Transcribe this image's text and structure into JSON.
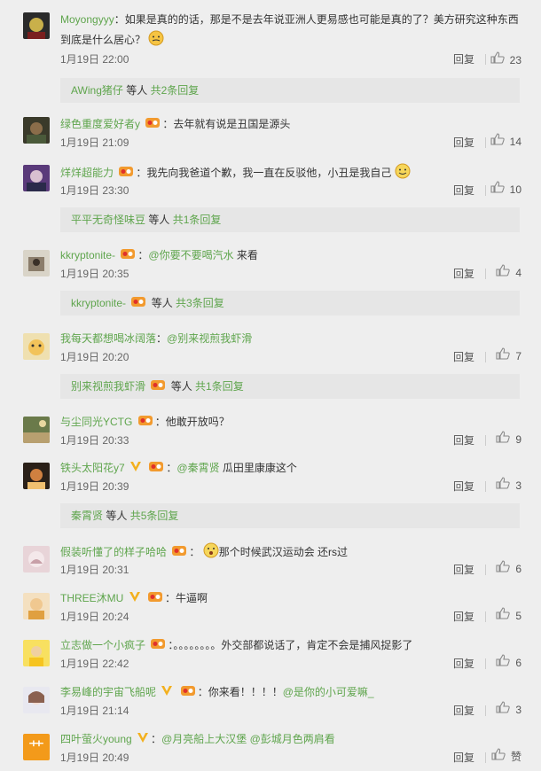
{
  "reply_label": "回复",
  "etc_text": " 等人 ",
  "comments": [
    {
      "user": "Moyongyyy",
      "colon": "：",
      "text": "如果是真的的话，那是不是去年说亚洲人更易感也可能是真的了？美方研究这种东西",
      "text2": "到底是什么居心？",
      "time": "1月19日 22:00",
      "likes": "23",
      "emoji": "thinking",
      "sub": {
        "user": "AWing猪仔",
        "count": "共2条回复"
      }
    },
    {
      "user": "绿色重度爱好者y",
      "colon": "：",
      "text": "去年就有说是丑国是源头",
      "time": "1月19日 21:09",
      "likes": "14"
    },
    {
      "user": "烊烊超能力",
      "colon": "：",
      "text": "我先向我爸道个歉，我一直在反驳他，小丑是我自己",
      "time": "1月19日 23:30",
      "likes": "10",
      "emoji": "smile",
      "sub": {
        "user": "平平无奇怪味豆",
        "count": "共1条回复"
      }
    },
    {
      "user": "kkryptonite-",
      "colon": "：",
      "mention": "@你要不要喝汽水",
      "text": " 来看",
      "time": "1月19日 20:35",
      "likes": "4",
      "sub": {
        "user": "kkryptonite-",
        "count": "共3条回复"
      }
    },
    {
      "user": "我每天都想喝冰阔落",
      "colon": "：",
      "mention": "@别来视煎我虾滑",
      "text": "",
      "time": "1月19日 20:20",
      "likes": "7",
      "sub": {
        "user": "别来视煎我虾滑",
        "count": "共1条回复"
      }
    },
    {
      "user": "与尘同光YCTG",
      "colon": "：",
      "text": "他敢开放吗？",
      "time": "1月19日 20:33",
      "likes": "9"
    },
    {
      "user": "铁头太阳花y7",
      "colon": "：",
      "mention": "@秦霄贤",
      "text": " 瓜田里康康这个",
      "time": "1月19日 20:39",
      "likes": "3",
      "sub": {
        "user": "秦霄贤",
        "count": "共5条回复"
      }
    },
    {
      "user": "假装听懂了的样子哈哈",
      "colon": "：",
      "text": "那个时候武汉运动会 还rs过",
      "time": "1月19日 20:31",
      "likes": "6"
    },
    {
      "user": "THREE沐MU",
      "colon": "：",
      "text": "牛逼啊",
      "time": "1月19日 20:24",
      "likes": "5"
    },
    {
      "user": "立志做一个小疯子",
      "colon": "：",
      "text": "。。。。。。。。外交部都说话了，肯定不会是捕风捉影了",
      "time": "1月19日 22:42",
      "likes": "6"
    },
    {
      "user": "李易峰的宇宙飞船呢",
      "colon": "：",
      "text": "你来看！！！！",
      "mention": "@是你的小可爱嘛_",
      "time": "1月19日 21:14",
      "likes": "3"
    },
    {
      "user": "四叶萤火young",
      "colon": "：",
      "mention": "@月亮船上大汉堡",
      "mention2": "@彭城月色两肩看",
      "text": " ",
      "time": "1月19日 20:49",
      "likes": "赞"
    }
  ],
  "colors": {
    "username": "#5fa54d",
    "background": "#eeeeee",
    "sub_background": "#e6e6e6"
  }
}
